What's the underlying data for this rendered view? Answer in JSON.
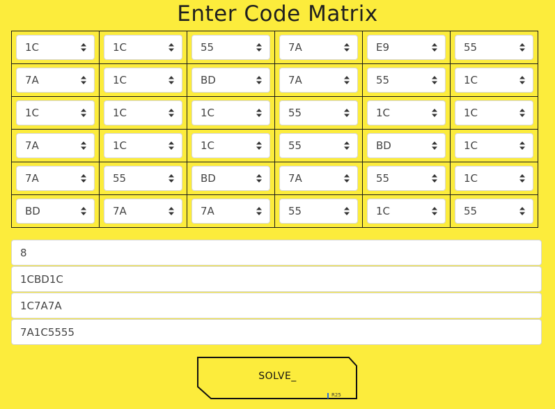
{
  "title": "Enter Code Matrix",
  "matrix": [
    [
      "1C",
      "1C",
      "55",
      "7A",
      "E9",
      "55"
    ],
    [
      "7A",
      "1C",
      "BD",
      "7A",
      "55",
      "1C"
    ],
    [
      "1C",
      "1C",
      "1C",
      "55",
      "1C",
      "1C"
    ],
    [
      "7A",
      "1C",
      "1C",
      "55",
      "BD",
      "1C"
    ],
    [
      "7A",
      "55",
      "BD",
      "7A",
      "55",
      "1C"
    ],
    [
      "BD",
      "7A",
      "7A",
      "55",
      "1C",
      "55"
    ]
  ],
  "inputs": {
    "buffer_size": "8",
    "sequence_1": "1CBD1C",
    "sequence_2": "1C7A7A",
    "sequence_3": "7A1C5555"
  },
  "solve_button": {
    "label": "SOLVE_",
    "code": "R25"
  },
  "icon": "select-updown-icon"
}
